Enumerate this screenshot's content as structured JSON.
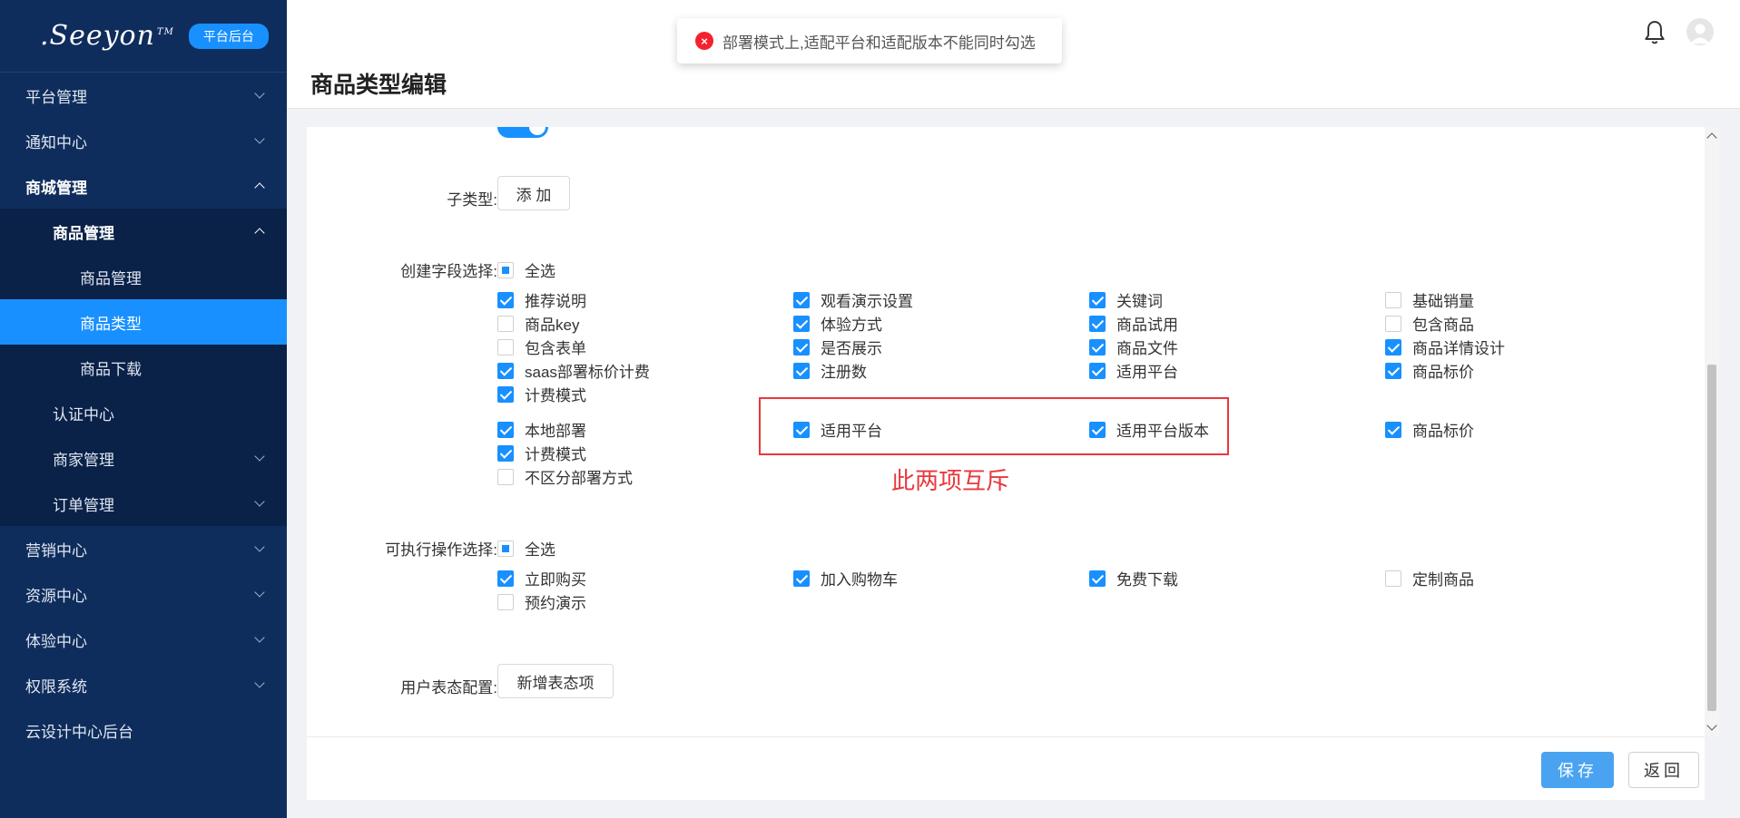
{
  "brand": {
    "logo": ".Seeyon",
    "tm": "TM",
    "badge": "平台后台"
  },
  "sidebar": {
    "items": [
      {
        "label": "平台管理"
      },
      {
        "label": "通知中心"
      },
      {
        "label": "商城管理"
      },
      {
        "label": "商品管理"
      },
      {
        "label": "商品管理"
      },
      {
        "label": "商品类型"
      },
      {
        "label": "商品下载"
      },
      {
        "label": "认证中心"
      },
      {
        "label": "商家管理"
      },
      {
        "label": "订单管理"
      },
      {
        "label": "营销中心"
      },
      {
        "label": "资源中心"
      },
      {
        "label": "体验中心"
      },
      {
        "label": "权限系统"
      },
      {
        "label": "云设计中心后台"
      }
    ]
  },
  "header": {
    "title": "商品类型编辑"
  },
  "toast": {
    "icon": "×",
    "message": "部署模式上,适配平台和适配版本不能同时勾选"
  },
  "form": {
    "subtype_label": "子类型:",
    "subtype_button": "添 加",
    "fields_label": "创建字段选择:",
    "fields_select_all": "全选",
    "fields": [
      {
        "label": "推荐说明",
        "checked": true
      },
      {
        "label": "观看演示设置",
        "checked": true
      },
      {
        "label": "关键词",
        "checked": true
      },
      {
        "label": "基础销量",
        "checked": false
      },
      {
        "label": "商品key",
        "checked": false
      },
      {
        "label": "体验方式",
        "checked": true
      },
      {
        "label": "商品试用",
        "checked": true
      },
      {
        "label": "包含商品",
        "checked": false
      },
      {
        "label": "包含表单",
        "checked": false
      },
      {
        "label": "是否展示",
        "checked": true
      },
      {
        "label": "商品文件",
        "checked": true
      },
      {
        "label": "商品详情设计",
        "checked": true
      },
      {
        "label": "saas部署标价计费",
        "checked": true
      },
      {
        "label": "注册数",
        "checked": true
      },
      {
        "label": "适用平台",
        "checked": true
      },
      {
        "label": "商品标价",
        "checked": true
      },
      {
        "label": "计费模式",
        "checked": true
      },
      {
        "label": "本地部署",
        "checked": true
      },
      {
        "label": "适用平台",
        "checked": true
      },
      {
        "label": "适用平台版本",
        "checked": true
      },
      {
        "label": "商品标价",
        "checked": true
      },
      {
        "label": "计费模式",
        "checked": true
      },
      {
        "label": "不区分部署方式",
        "checked": false
      }
    ],
    "annotation": "此两项互斥",
    "actions_label": "可执行操作选择:",
    "actions_select_all": "全选",
    "actions": [
      {
        "label": "立即购买",
        "checked": true
      },
      {
        "label": "加入购物车",
        "checked": true
      },
      {
        "label": "免费下载",
        "checked": true
      },
      {
        "label": "定制商品",
        "checked": false
      },
      {
        "label": "预约演示",
        "checked": false
      }
    ],
    "user_label": "用户表态配置:",
    "user_button": "新增表态项"
  },
  "footer": {
    "save": "保存",
    "back": "返回"
  },
  "colors": {
    "sidebar": "#0f2d5c",
    "accent": "#1890ff",
    "annotation": "#e8383d"
  }
}
